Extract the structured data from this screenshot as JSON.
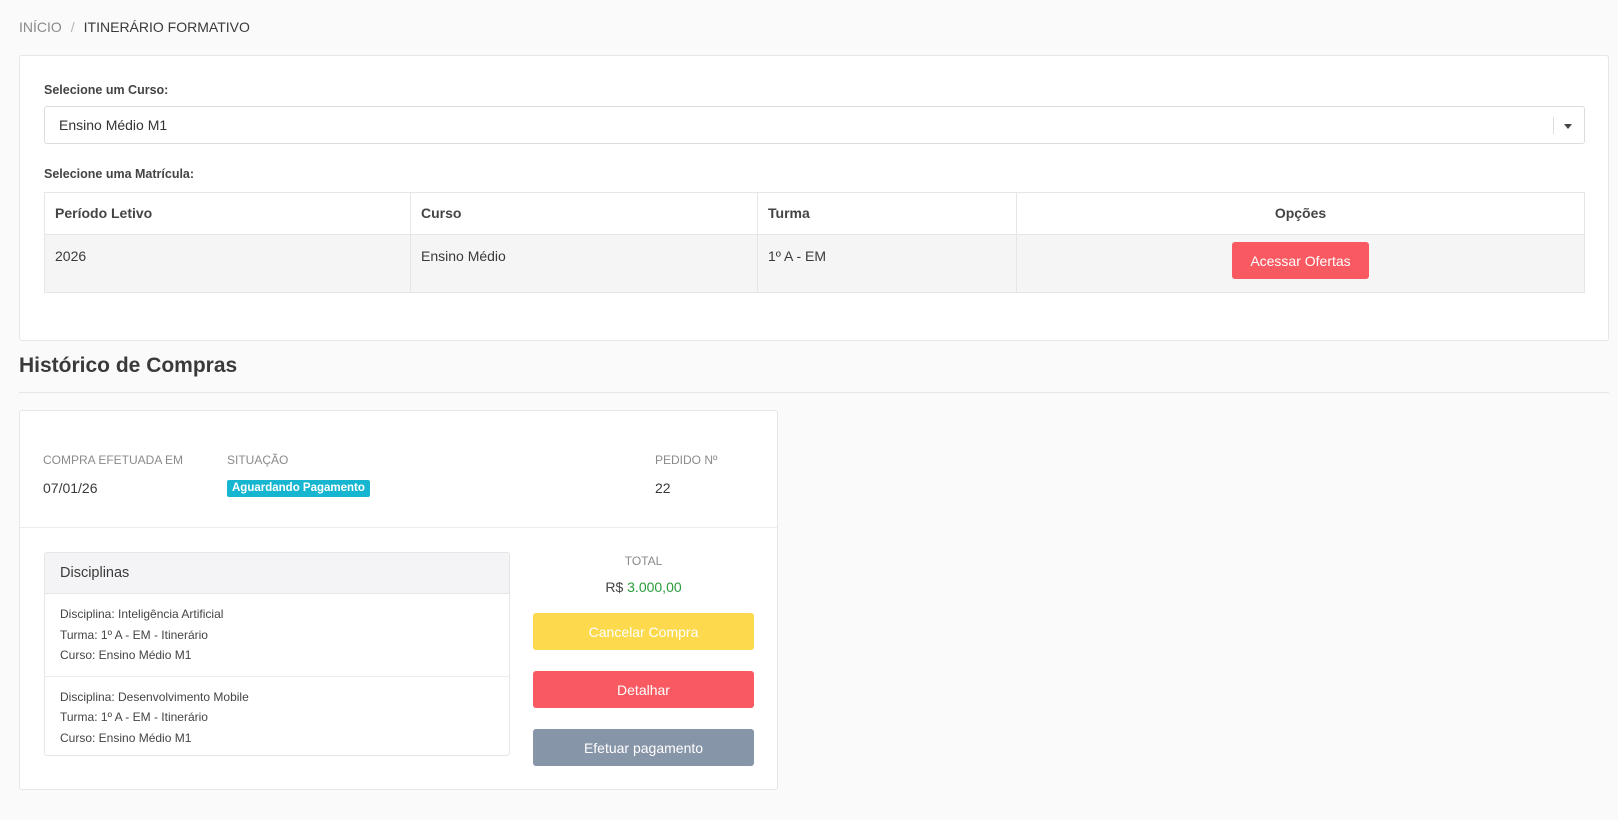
{
  "breadcrumb": {
    "home": "INÍCIO",
    "separator": "/",
    "current": "ITINERÁRIO FORMATIVO"
  },
  "course_select": {
    "label": "Selecione um Curso:",
    "value": "Ensino Médio M1"
  },
  "enrollment": {
    "label": "Selecione uma Matrícula:",
    "columns": [
      "Período Letivo",
      "Curso",
      "Turma",
      "Opções"
    ],
    "rows": [
      {
        "periodo": "2026",
        "curso": "Ensino Médio",
        "turma": "1º A - EM",
        "action": "Acessar Ofertas"
      }
    ]
  },
  "history": {
    "title": "Histórico de Compras",
    "purchase": {
      "date_label": "COMPRA EFETUADA EM",
      "date": "07/01/26",
      "status_label": "SITUAÇÃO",
      "status": "Aguardando Pagamento",
      "order_label": "PEDIDO Nº",
      "order": "22",
      "disciplines_title": "Disciplinas",
      "disciplines": [
        {
          "disciplina": "Disciplina: Inteligência Artificial",
          "turma": "Turma: 1º A - EM - Itinerário",
          "curso": "Curso: Ensino Médio M1"
        },
        {
          "disciplina": "Disciplina: Desenvolvimento Mobile",
          "turma": "Turma: 1º A - EM - Itinerário",
          "curso": "Curso: Ensino Médio M1"
        }
      ],
      "total_label": "TOTAL",
      "currency": "R$",
      "total": "3.000,00",
      "buttons": {
        "cancel": "Cancelar Compra",
        "details": "Detalhar",
        "pay": "Efetuar pagamento"
      }
    }
  },
  "colors": {
    "primary_red": "#f95a61",
    "warning_yellow": "#fdd94e",
    "muted_gray": "#8795a8",
    "badge_cyan": "#17b6d0",
    "money_green": "#2a9a3c"
  }
}
